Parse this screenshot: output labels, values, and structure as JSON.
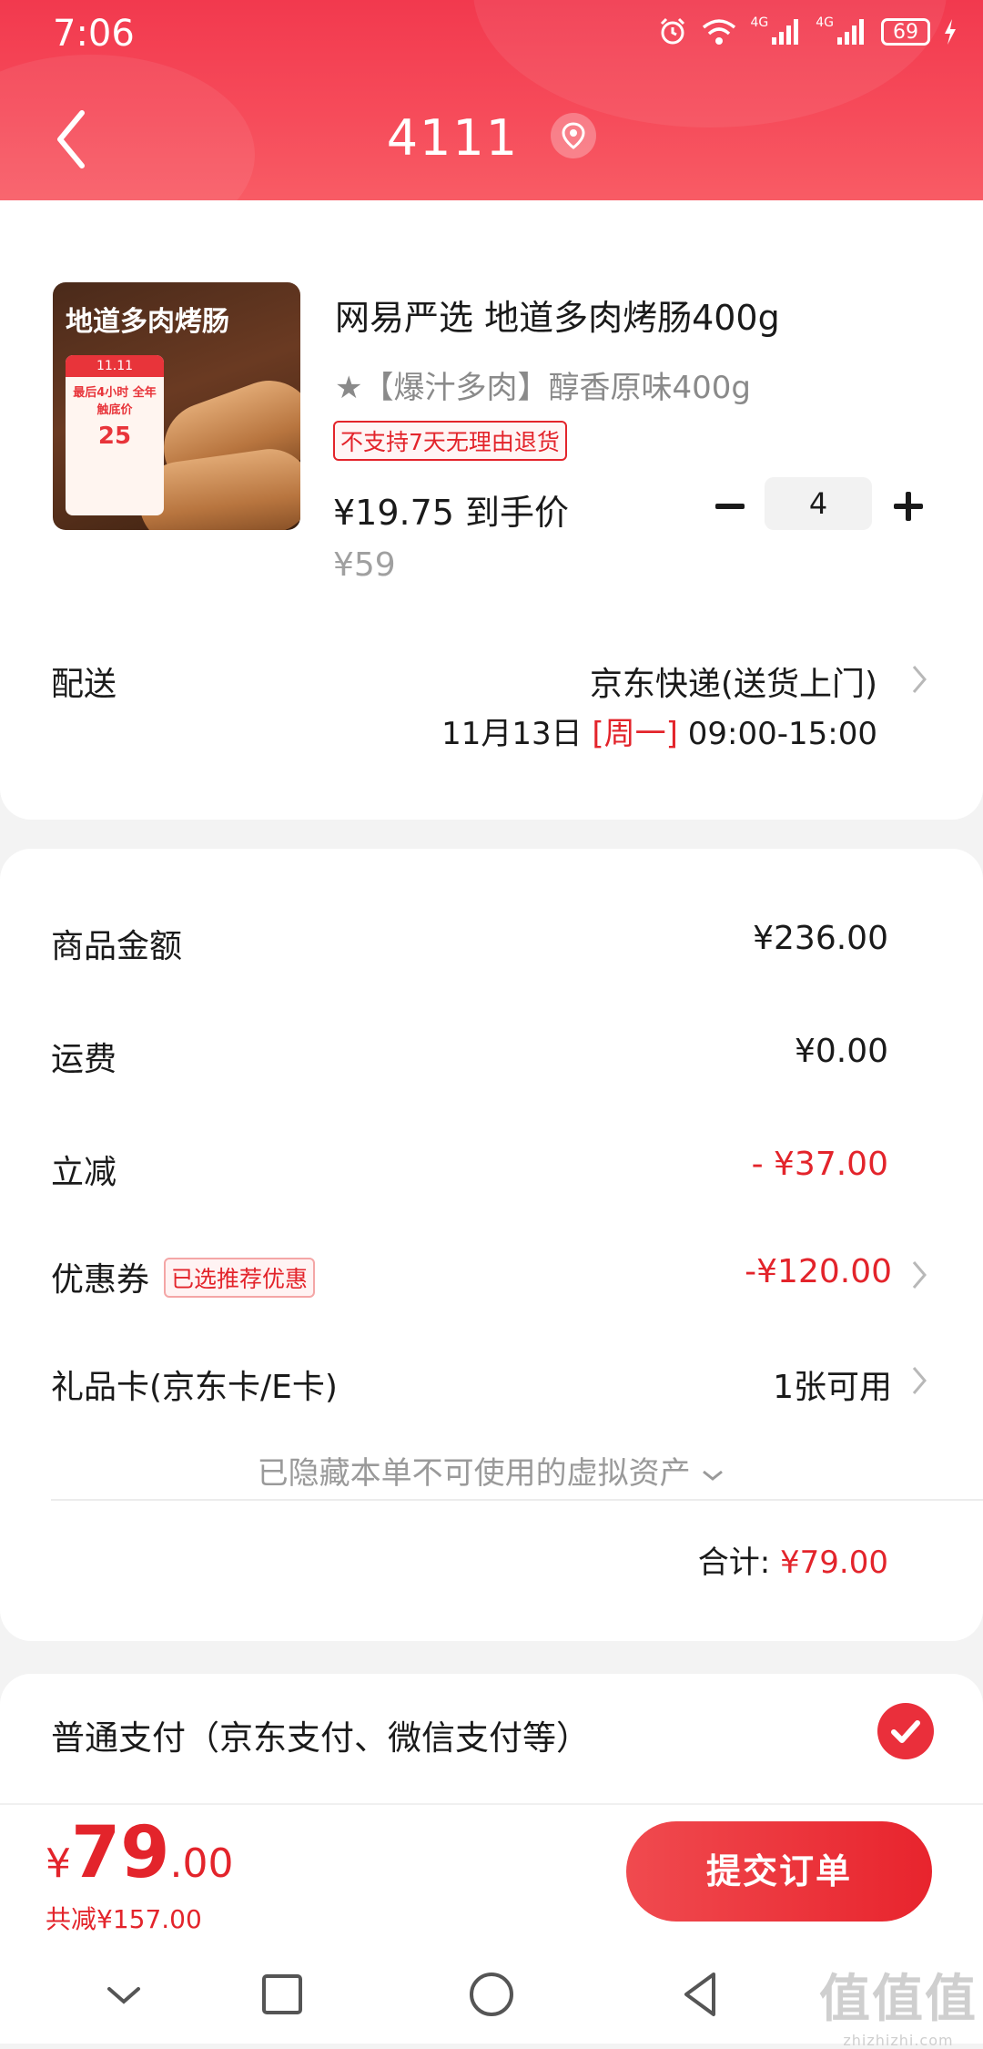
{
  "status_bar": {
    "time": "7:06",
    "battery": "69",
    "signal_label_1": "4G",
    "signal_label_2": "4G"
  },
  "header": {
    "title": "4111"
  },
  "product": {
    "thumb_title": "地道多肉烤肠",
    "thumb_promo_top": "11.11",
    "thumb_promo_text": "最后4小时 全年触底价",
    "thumb_promo_price": "25",
    "name": "网易严选 地道多肉烤肠400g",
    "spec": "★【爆汁多肉】醇香原味400g",
    "no_return_tag": "不支持7天无理由退货",
    "price_now": "¥19.75 到手价",
    "price_original": "¥59",
    "quantity": "4"
  },
  "shipping": {
    "label": "配送",
    "method": "京东快递(送货上门)",
    "date": "11月13日",
    "weekday": "[周一]",
    "time_window": "09:00-15:00"
  },
  "summary": {
    "rows": [
      {
        "label": "商品金额",
        "value": "¥236.00"
      },
      {
        "label": "运费",
        "value": "¥0.00"
      },
      {
        "label": "立减",
        "value": "- ¥37.00"
      },
      {
        "label": "优惠券",
        "tag": "已选推荐优惠",
        "value": "-¥120.00"
      },
      {
        "label": "礼品卡(京东卡/E卡)",
        "value": "1张可用"
      }
    ],
    "hidden_assets": "已隐藏本单不可使用的虚拟资产",
    "total_label": "合计:",
    "total_value": "¥79.00"
  },
  "payment": {
    "method": "普通支付（京东支付、微信支付等）"
  },
  "bottom": {
    "currency": "¥",
    "amount_int": "79",
    "amount_dec": ".00",
    "saved": "共减¥157.00",
    "submit": "提交订单"
  },
  "watermark": {
    "big": "值值值",
    "small": "zhizhizhi.com"
  },
  "colors": {
    "brand_red": "#e3242b",
    "header_red": "#f2394e"
  }
}
